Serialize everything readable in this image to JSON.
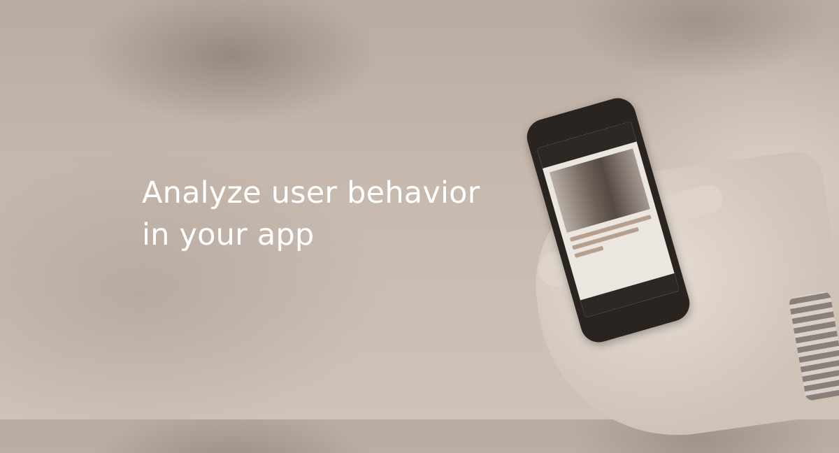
{
  "headline": {
    "line1": "Analyze user behavior",
    "line2": "in your app"
  },
  "colors": {
    "text": "#ffffff",
    "background": "#c6b8ad"
  }
}
